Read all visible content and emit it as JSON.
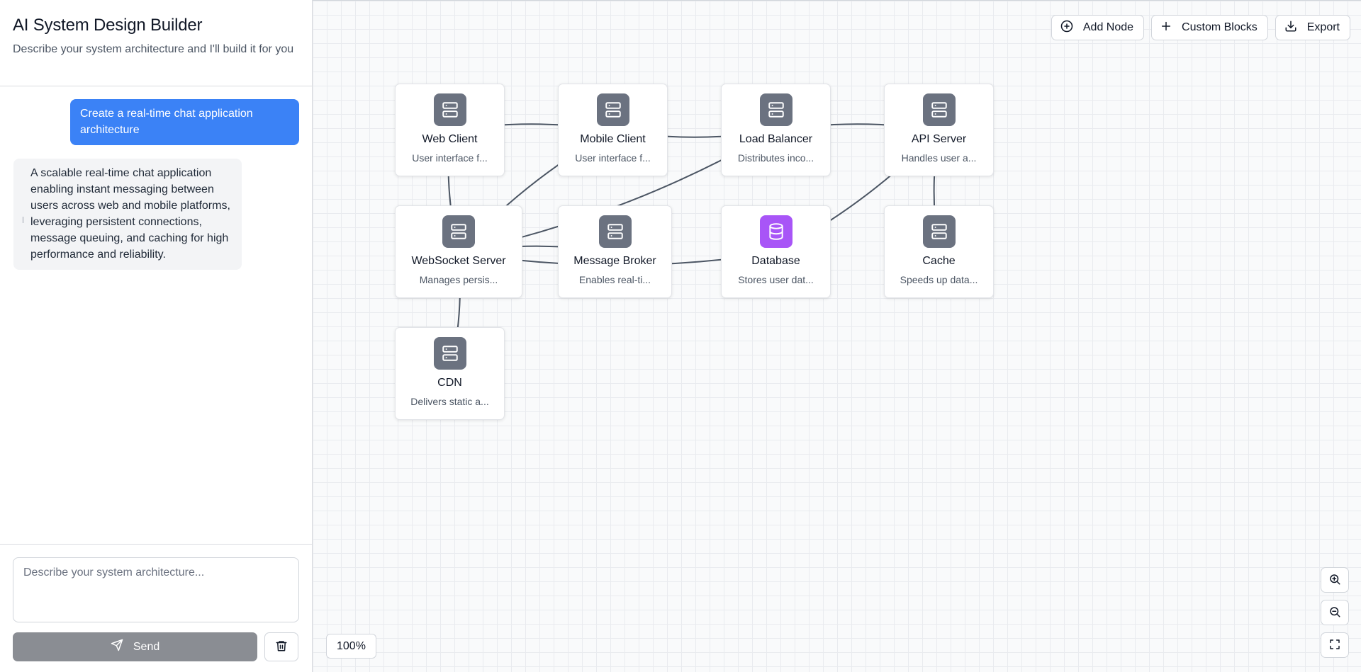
{
  "sidebar": {
    "title": "AI System Design Builder",
    "subtitle": "Describe your system architecture and I'll build it for you"
  },
  "chat": {
    "messages": [
      {
        "role": "user",
        "text": "Create a real-time chat application architecture"
      },
      {
        "role": "assistant",
        "text": "A scalable real-time chat application enabling instant messaging between users across web and mobile platforms, leveraging persistent connections, message queuing, and caching for high performance and reliability."
      }
    ]
  },
  "composer": {
    "placeholder": "Describe your system architecture...",
    "send_label": "Send",
    "send_icon": "paper-plane-icon",
    "clear_icon": "trash-icon"
  },
  "toolbar": {
    "add_node_label": "Add Node",
    "custom_blocks_label": "Custom Blocks",
    "export_label": "Export"
  },
  "colors": {
    "accent": "#3b82f6",
    "node_icon": "#6b7280",
    "database_icon": "#a855f7",
    "edge": "#4b5563"
  },
  "nodes": [
    {
      "id": "web-client",
      "title": "Web Client",
      "desc": "User interface f...",
      "icon": "server-icon"
    },
    {
      "id": "mobile-client",
      "title": "Mobile Client",
      "desc": "User interface f...",
      "icon": "server-icon"
    },
    {
      "id": "load-balancer",
      "title": "Load Balancer",
      "desc": "Distributes inco...",
      "icon": "server-icon"
    },
    {
      "id": "api-server",
      "title": "API Server",
      "desc": "Handles user a...",
      "icon": "server-icon"
    },
    {
      "id": "websocket-server",
      "title": "WebSocket Server",
      "desc": "Manages persis...",
      "icon": "server-icon"
    },
    {
      "id": "message-broker",
      "title": "Message Broker",
      "desc": "Enables real-ti...",
      "icon": "server-icon"
    },
    {
      "id": "database",
      "title": "Database",
      "desc": "Stores user dat...",
      "icon": "database-icon"
    },
    {
      "id": "cache",
      "title": "Cache",
      "desc": "Speeds up data...",
      "icon": "server-icon"
    },
    {
      "id": "cdn",
      "title": "CDN",
      "desc": "Delivers static a...",
      "icon": "server-icon"
    }
  ],
  "edges": [
    {
      "from": "web-client",
      "to": "mobile-client"
    },
    {
      "from": "mobile-client",
      "to": "load-balancer"
    },
    {
      "from": "load-balancer",
      "to": "api-server"
    },
    {
      "from": "web-client",
      "to": "websocket-server"
    },
    {
      "from": "load-balancer",
      "to": "websocket-server"
    },
    {
      "from": "mobile-client",
      "to": "websocket-server"
    },
    {
      "from": "api-server",
      "to": "database"
    },
    {
      "from": "api-server",
      "to": "cache"
    },
    {
      "from": "websocket-server",
      "to": "message-broker"
    },
    {
      "from": "websocket-server",
      "to": "database"
    },
    {
      "from": "websocket-server",
      "to": "cdn"
    }
  ],
  "zoom": {
    "level": "100%"
  }
}
